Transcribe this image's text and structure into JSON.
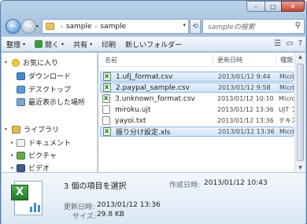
{
  "window": {
    "controls": {
      "minimize": "–",
      "maximize": "□",
      "close": "✕"
    }
  },
  "nav": {
    "back_icon": "←",
    "forward_icon": "→",
    "dropdown_icon": "▾",
    "breadcrumb": [
      "sample",
      "sample"
    ],
    "breadcrumb_separator": "›",
    "refresh_icon": "⟲",
    "search_placeholder": "sampleの検索",
    "search_icon": "⚲"
  },
  "toolbar": {
    "organize": "整理",
    "open": "開く",
    "share": "共有",
    "print": "印刷",
    "new_folder": "新しいフォルダー",
    "view_icon": "☰",
    "pane_icon": "▭",
    "help_icon": "?"
  },
  "sidebar": {
    "favorites_label": "お気に入り",
    "favorites": [
      "ダウンロード",
      "デスクトップ",
      "最近表示した場所"
    ],
    "libraries_label": "ライブラリ",
    "libraries": [
      "ドキュメント",
      "ピクチャ",
      "ビデオ"
    ]
  },
  "columns": {
    "name": "名前",
    "date": "更新日時",
    "type": "種類"
  },
  "files": [
    {
      "name": "1.ufj_format.csv",
      "date": "2013/01/12 9:44",
      "type": "Microso",
      "selected": true,
      "icon": "csv"
    },
    {
      "name": "2.paypal_sample.csv",
      "date": "2013/01/12 9:58",
      "type": "Microso",
      "selected": true,
      "icon": "csv"
    },
    {
      "name": "3.unknown_format.csv",
      "date": "2013/01/12 10:10",
      "type": "Microso",
      "selected": false,
      "icon": "csv"
    },
    {
      "name": "miroku.ujt",
      "date": "2013/01/12 13:36",
      "type": "UJT ファ",
      "selected": false,
      "icon": "plain"
    },
    {
      "name": "yayoi.txt",
      "date": "2013/01/12 13:36",
      "type": "テキス",
      "selected": false,
      "icon": "plain"
    },
    {
      "name": "振り分け設定.xls",
      "date": "2013/01/12 13:36",
      "type": "Microso",
      "selected": true,
      "icon": "xls"
    }
  ],
  "details": {
    "selection_text": "3 個の項目を選択",
    "created_label": "作成日時:",
    "created_value": "2013/01/12 10:43",
    "modified_label": "更新日時:",
    "modified_value": "2013/01/12 13:36",
    "size_label": "サイズ:",
    "size_value": "29.8 KB",
    "icon_letter": "X"
  },
  "colors": {
    "accent": "#3f84cc",
    "selection": "#cfe3f8",
    "chrome": "#b9d1ea"
  }
}
